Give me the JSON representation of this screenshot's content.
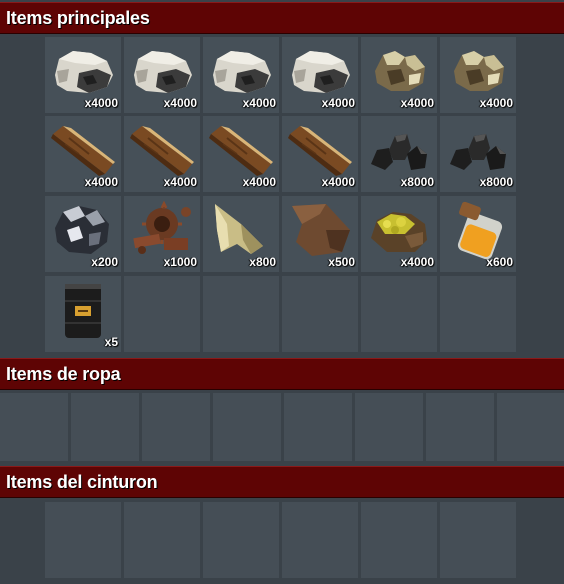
{
  "sections": {
    "main": {
      "title": "Items principales"
    },
    "clothing": {
      "title": "Items de ropa"
    },
    "belt": {
      "title": "Items del cinturon"
    }
  },
  "main_items": [
    {
      "name": "stone",
      "icon": "stone-icon",
      "qty": "x4000"
    },
    {
      "name": "stone",
      "icon": "stone-icon",
      "qty": "x4000"
    },
    {
      "name": "stone",
      "icon": "stone-icon",
      "qty": "x4000"
    },
    {
      "name": "stone",
      "icon": "stone-icon",
      "qty": "x4000"
    },
    {
      "name": "metal-ore",
      "icon": "metal-ore-icon",
      "qty": "x4000"
    },
    {
      "name": "metal-ore",
      "icon": "metal-ore-icon",
      "qty": "x4000"
    },
    {
      "name": "wood",
      "icon": "wood-icon",
      "qty": "x4000"
    },
    {
      "name": "wood",
      "icon": "wood-icon",
      "qty": "x4000"
    },
    {
      "name": "wood",
      "icon": "wood-icon",
      "qty": "x4000"
    },
    {
      "name": "wood",
      "icon": "wood-icon",
      "qty": "x4000"
    },
    {
      "name": "charcoal",
      "icon": "charcoal-icon",
      "qty": "x8000"
    },
    {
      "name": "charcoal",
      "icon": "charcoal-icon",
      "qty": "x8000"
    },
    {
      "name": "hq-metal-ore",
      "icon": "hq-metal-ore-icon",
      "qty": "x200"
    },
    {
      "name": "metal-fragments",
      "icon": "metal-fragments-icon",
      "qty": "x1000"
    },
    {
      "name": "cloth",
      "icon": "cloth-icon",
      "qty": "x800"
    },
    {
      "name": "leather",
      "icon": "leather-icon",
      "qty": "x500"
    },
    {
      "name": "sulfur-ore",
      "icon": "sulfur-ore-icon",
      "qty": "x4000"
    },
    {
      "name": "low-grade-fuel",
      "icon": "fuel-jar-icon",
      "qty": "x600"
    },
    {
      "name": "oil-barrel",
      "icon": "oil-barrel-icon",
      "qty": "x5"
    }
  ],
  "colors": {
    "header_bg": "#5e0404",
    "panel_bg": "#3a4249",
    "slot_bg": "#465058"
  }
}
